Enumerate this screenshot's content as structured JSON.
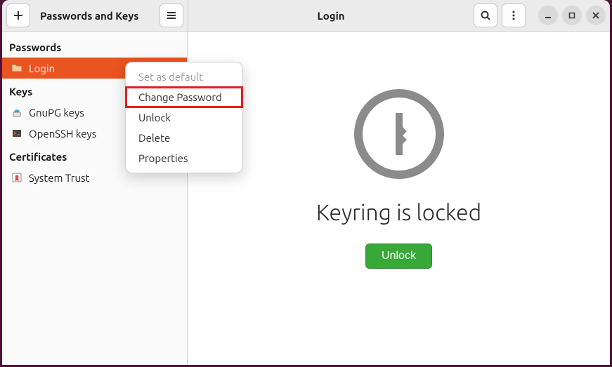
{
  "header": {
    "app_title": "Passwords and Keys",
    "context_title": "Login"
  },
  "sidebar": {
    "sections": {
      "passwords": {
        "label": "Passwords"
      },
      "keys": {
        "label": "Keys"
      },
      "certificates": {
        "label": "Certificates"
      }
    },
    "passwords_items": [
      {
        "label": "Login"
      }
    ],
    "keys_items": [
      {
        "label": "GnuPG keys"
      },
      {
        "label": "OpenSSH keys"
      }
    ],
    "certificates_items": [
      {
        "label": "System Trust"
      }
    ]
  },
  "content": {
    "heading": "Keyring is locked",
    "unlock_label": "Unlock"
  },
  "context_menu": {
    "items": [
      {
        "label": "Set as default",
        "disabled": true
      },
      {
        "label": "Change Password",
        "highlighted": true
      },
      {
        "label": "Unlock"
      },
      {
        "label": "Delete"
      },
      {
        "label": "Properties"
      }
    ]
  },
  "colors": {
    "accent": "#e95420",
    "unlock_green": "#38a838",
    "highlight_red": "#e02020"
  }
}
